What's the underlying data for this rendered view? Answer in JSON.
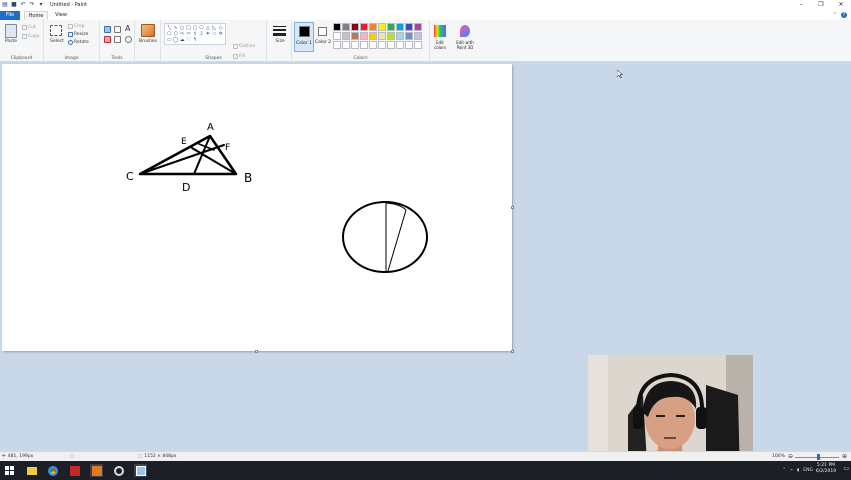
{
  "window": {
    "title": "Untitled - Paint"
  },
  "tabs": [
    {
      "label": "File",
      "active": false
    },
    {
      "label": "Home",
      "active": true
    },
    {
      "label": "View",
      "active": false
    }
  ],
  "ribbon": {
    "clipboard": {
      "label": "Clipboard",
      "paste": "Paste",
      "cut": "Cut",
      "copy": "Copy"
    },
    "image": {
      "label": "Image",
      "select": "Select",
      "crop": "Crop",
      "resize": "Resize",
      "rotate": "Rotate"
    },
    "tools": {
      "label": "Tools"
    },
    "brushes": {
      "label": "Brushes"
    },
    "shapes": {
      "label": "Shapes",
      "outline": "Outline",
      "fill": "Fill"
    },
    "size": {
      "label": "Size"
    },
    "color1": {
      "label": "Color 1",
      "value": "#000000"
    },
    "color2": {
      "label": "Color 2",
      "value": "#ffffff"
    },
    "colors": {
      "label": "Colors",
      "row1": [
        "#000000",
        "#7f7f7f",
        "#880015",
        "#ed1c24",
        "#ff7f27",
        "#fff200",
        "#22b14c",
        "#00a2e8",
        "#3f48cc",
        "#a349a4"
      ],
      "row2": [
        "#ffffff",
        "#c3c3c3",
        "#b97a57",
        "#ffaec9",
        "#ffc90e",
        "#efe4b0",
        "#b5e61d",
        "#99d9ea",
        "#7092be",
        "#c8bfe7"
      ],
      "row3": [
        "#ffffff",
        "#ffffff",
        "#ffffff",
        "#ffffff",
        "#ffffff",
        "#ffffff",
        "#ffffff",
        "#ffffff",
        "#ffffff",
        "#ffffff"
      ]
    },
    "edit_colors": "Edit colors",
    "edit_paint3d": "Edit with Paint 3D"
  },
  "drawing": {
    "labels": {
      "a": "A",
      "b": "B",
      "c": "C",
      "d": "D",
      "e": "E",
      "f": "F"
    }
  },
  "status": {
    "cursor_pos": "481, 199px",
    "canvas_size": "1152 × 848px",
    "zoom": "100%"
  },
  "taskbar": {
    "lang": "ENG",
    "time": "5:21 PM",
    "date": "6/2/2019"
  }
}
